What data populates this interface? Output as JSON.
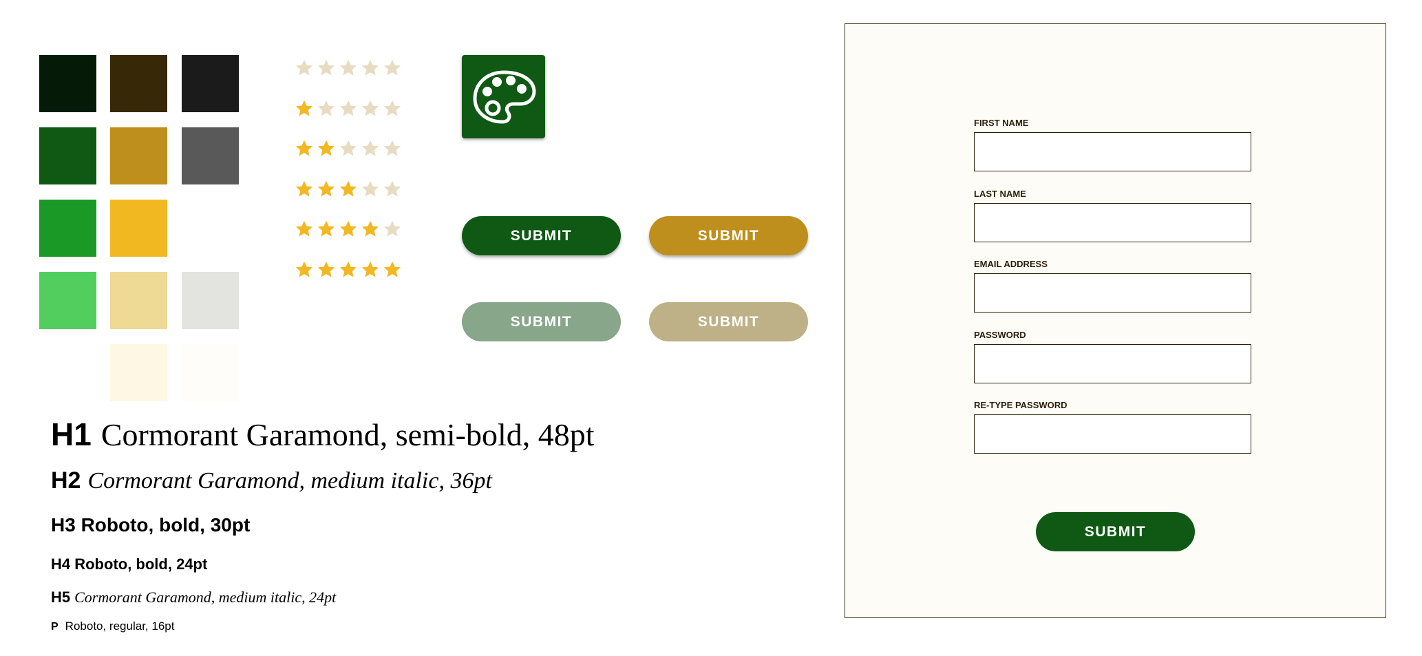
{
  "swatches": {
    "row1": [
      "#061a08",
      "#372807",
      "#1b1b1b"
    ],
    "row2": [
      "#0f5915",
      "#be8f1c",
      "#5a595a"
    ],
    "row3": [
      "#1a9926",
      "#f1b822"
    ],
    "row4": [
      "#52ce5f",
      "#eed995",
      "#e3e3df"
    ],
    "row5": [
      "#fef7e4",
      "#fefdf9"
    ]
  },
  "star_ratings": {
    "filled_color": "#f1b822",
    "empty_color": "#e7dcc2",
    "rows": [
      0,
      1,
      2,
      3,
      4,
      5
    ],
    "max": 5
  },
  "palette_icon": {
    "name": "palette-icon",
    "background": "#0f5915"
  },
  "buttons": [
    {
      "label": "SUBMIT",
      "color": "#0f5915",
      "state": "default"
    },
    {
      "label": "SUBMIT",
      "color": "#be8f1c",
      "state": "default"
    },
    {
      "label": "SUBMIT",
      "color": "#87a68a",
      "state": "disabled"
    },
    {
      "label": "SUBMIT",
      "color": "#beb087",
      "state": "disabled"
    }
  ],
  "typography": {
    "h1": {
      "tag": "H1",
      "text": "Cormorant Garamond, semi-bold, 48pt"
    },
    "h2": {
      "tag": "H2",
      "text": "Cormorant Garamond, medium italic, 36pt"
    },
    "h3": {
      "text": "H3 Roboto, bold, 30pt"
    },
    "h4": {
      "text": "H4 Roboto, bold, 24pt"
    },
    "h5": {
      "tag": "H5",
      "text": "Cormorant Garamond, medium italic, 24pt"
    },
    "p": {
      "tag": "P",
      "text": "Roboto, regular, 16pt"
    }
  },
  "form": {
    "fields": [
      {
        "label": "FIRST NAME",
        "value": ""
      },
      {
        "label": "LAST NAME",
        "value": ""
      },
      {
        "label": "EMAIL ADDRESS",
        "value": ""
      },
      {
        "label": "PASSWORD",
        "value": ""
      },
      {
        "label": "RE-TYPE PASSWORD",
        "value": ""
      }
    ],
    "submit_label": "SUBMIT",
    "submit_color": "#0f5915"
  }
}
